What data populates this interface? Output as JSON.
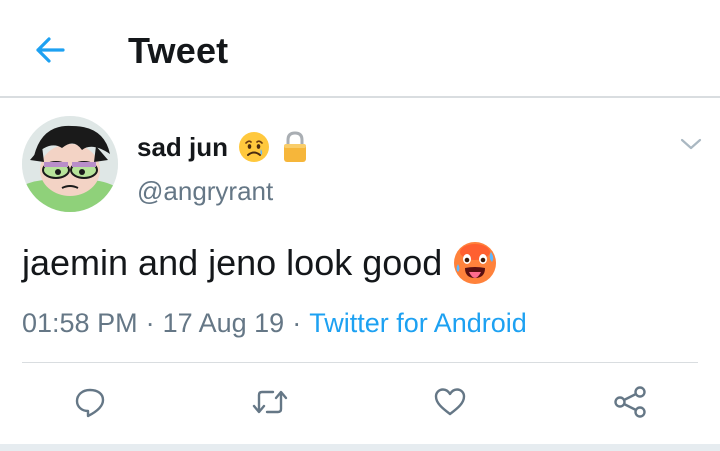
{
  "header": {
    "title": "Tweet",
    "back_icon": "arrow-left-icon"
  },
  "tweet": {
    "display_name": "sad jun",
    "name_emoji": "sad-face-emoji",
    "protected_icon": "lock-icon",
    "handle": "@angryrant",
    "text": "jaemin and jeno look good",
    "text_emoji": "hot-face-emoji",
    "time": "01:58 PM",
    "separator": "·",
    "date": "17 Aug 19",
    "source": "Twitter for Android",
    "menu_icon": "chevron-down-icon"
  },
  "actions": {
    "reply_icon": "reply-icon",
    "retweet_icon": "retweet-icon",
    "like_icon": "heart-icon",
    "share_icon": "share-icon"
  },
  "colors": {
    "accent": "#1da1f2",
    "text_primary": "#14171a",
    "text_secondary": "#657786",
    "divider": "#d9dde0"
  }
}
